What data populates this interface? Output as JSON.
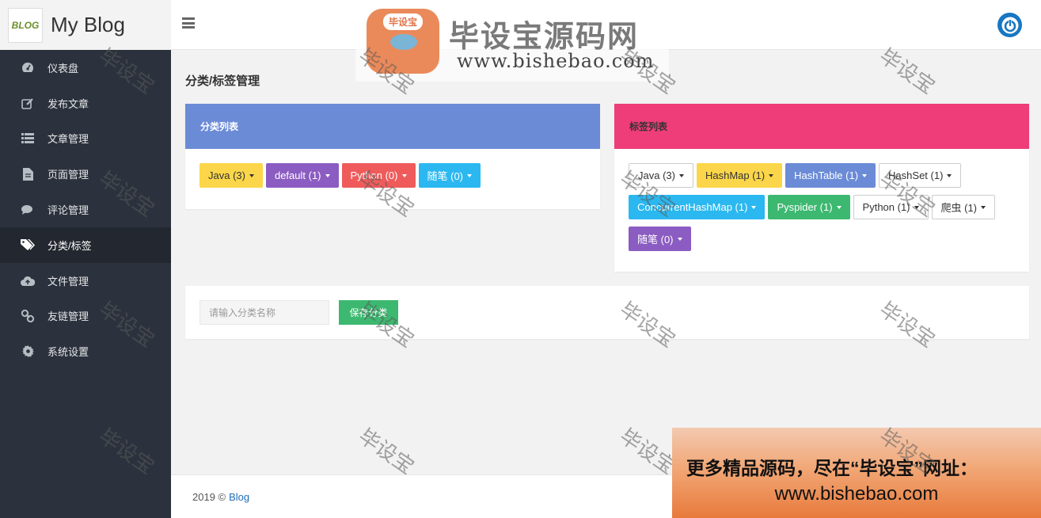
{
  "brand": {
    "logo_text": "BLOG",
    "title": "My Blog"
  },
  "sidebar": {
    "items": [
      {
        "label": "仪表盘",
        "icon": "dashboard-icon",
        "active": false
      },
      {
        "label": "发布文章",
        "icon": "edit-icon",
        "active": false
      },
      {
        "label": "文章管理",
        "icon": "list-icon",
        "active": false
      },
      {
        "label": "页面管理",
        "icon": "file-icon",
        "active": false
      },
      {
        "label": "评论管理",
        "icon": "comments-icon",
        "active": false
      },
      {
        "label": "分类/标签",
        "icon": "tags-icon",
        "active": true
      },
      {
        "label": "文件管理",
        "icon": "cloud-upload-icon",
        "active": false
      },
      {
        "label": "友链管理",
        "icon": "link-icon",
        "active": false
      },
      {
        "label": "系统设置",
        "icon": "gear-icon",
        "active": false
      }
    ]
  },
  "page": {
    "title": "分类/标签管理"
  },
  "categories": {
    "title": "分类列表",
    "header_color": "#6b8bd6",
    "items": [
      {
        "label": "Java (3)",
        "bg": "#fcd64a",
        "fg": "#333333"
      },
      {
        "label": "default (1)",
        "bg": "#8b5cc1",
        "fg": "#ffffff"
      },
      {
        "label": "Python (0)",
        "bg": "#ef5b5b",
        "fg": "#ffffff"
      },
      {
        "label": "随笔 (0)",
        "bg": "#2bb8f0",
        "fg": "#ffffff"
      }
    ]
  },
  "tags": {
    "title": "标签列表",
    "header_color": "#ee3d78",
    "items": [
      {
        "label": "Java (3)",
        "style": "outline"
      },
      {
        "label": "HashMap (1)",
        "bg": "#fcd64a",
        "fg": "#333333"
      },
      {
        "label": "HashTable (1)",
        "bg": "#6b8bd6",
        "fg": "#ffffff"
      },
      {
        "label": "HashSet (1)",
        "style": "outline"
      },
      {
        "label": "ConcurrentHashMap (1)",
        "bg": "#2bb8f0",
        "fg": "#ffffff"
      },
      {
        "label": "Pyspider (1)",
        "bg": "#3cb870",
        "fg": "#ffffff"
      },
      {
        "label": "Python (1)",
        "style": "outline"
      },
      {
        "label": "爬虫 (1)",
        "style": "outline"
      },
      {
        "label": "随笔 (0)",
        "bg": "#8b5cc1",
        "fg": "#ffffff"
      }
    ]
  },
  "form": {
    "placeholder": "请输入分类名称",
    "save_label": "保存分类"
  },
  "footer": {
    "copyright": "2019 ©",
    "link_text": "Blog"
  },
  "watermark": {
    "logo_label": "毕设宝",
    "banner_title": "毕设宝源码网",
    "banner_url": "www.bishebao.com",
    "stamp": "毕设宝",
    "promo_line1": "更多精品源码，尽在“毕设宝”网址：",
    "promo_line2": "www.bishebao.com"
  }
}
